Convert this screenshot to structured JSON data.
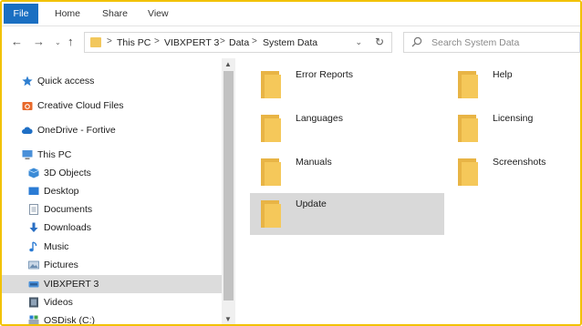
{
  "ribbon": {
    "tabs": [
      "File",
      "Home",
      "Share",
      "View"
    ]
  },
  "nav": {
    "back": "←",
    "forward": "→",
    "recent": "⌄",
    "up": "↑"
  },
  "address": {
    "crumbs": [
      "This PC",
      "VIBXPERT 3",
      "Data",
      "System Data"
    ],
    "separator": ">",
    "dropdown": "⌄",
    "refresh": "↻"
  },
  "search": {
    "placeholder": "Search System Data"
  },
  "sidebar": {
    "items": [
      {
        "label": "Quick access",
        "icon": "star-icon",
        "color": "#2f7fd0"
      },
      {
        "label": "Creative Cloud Files",
        "icon": "creative-cloud-icon",
        "color": "#e8692b"
      },
      {
        "label": "OneDrive - Fortive",
        "icon": "cloud-icon",
        "color": "#1f6fc5"
      },
      {
        "label": "This PC",
        "icon": "computer-icon",
        "color": "#4a90d9"
      },
      {
        "label": "3D Objects",
        "icon": "cube-icon",
        "color": "#3a8ad6"
      },
      {
        "label": "Desktop",
        "icon": "desktop-icon",
        "color": "#2a7bd4"
      },
      {
        "label": "Documents",
        "icon": "document-icon",
        "color": "#7a8ca0"
      },
      {
        "label": "Downloads",
        "icon": "download-icon",
        "color": "#2a6fc4"
      },
      {
        "label": "Music",
        "icon": "music-icon",
        "color": "#2a7bd4"
      },
      {
        "label": "Pictures",
        "icon": "pictures-icon",
        "color": "#6a8caf"
      },
      {
        "label": "VIBXPERT 3",
        "icon": "drive-icon",
        "color": "#4a90d9"
      },
      {
        "label": "Videos",
        "icon": "video-icon",
        "color": "#4a5a6a"
      },
      {
        "label": "OSDisk (C:)",
        "icon": "disk-icon",
        "color": "#4a90d9"
      }
    ],
    "selected": "VIBXPERT 3"
  },
  "folders": [
    {
      "name": "Error Reports"
    },
    {
      "name": "Help"
    },
    {
      "name": "Languages"
    },
    {
      "name": "Licensing"
    },
    {
      "name": "Manuals"
    },
    {
      "name": "Screenshots"
    },
    {
      "name": "Update"
    }
  ],
  "colors": {
    "accent": "#1a6fc2",
    "folder": "#f5c85a",
    "selected": "#d9d9d9"
  }
}
